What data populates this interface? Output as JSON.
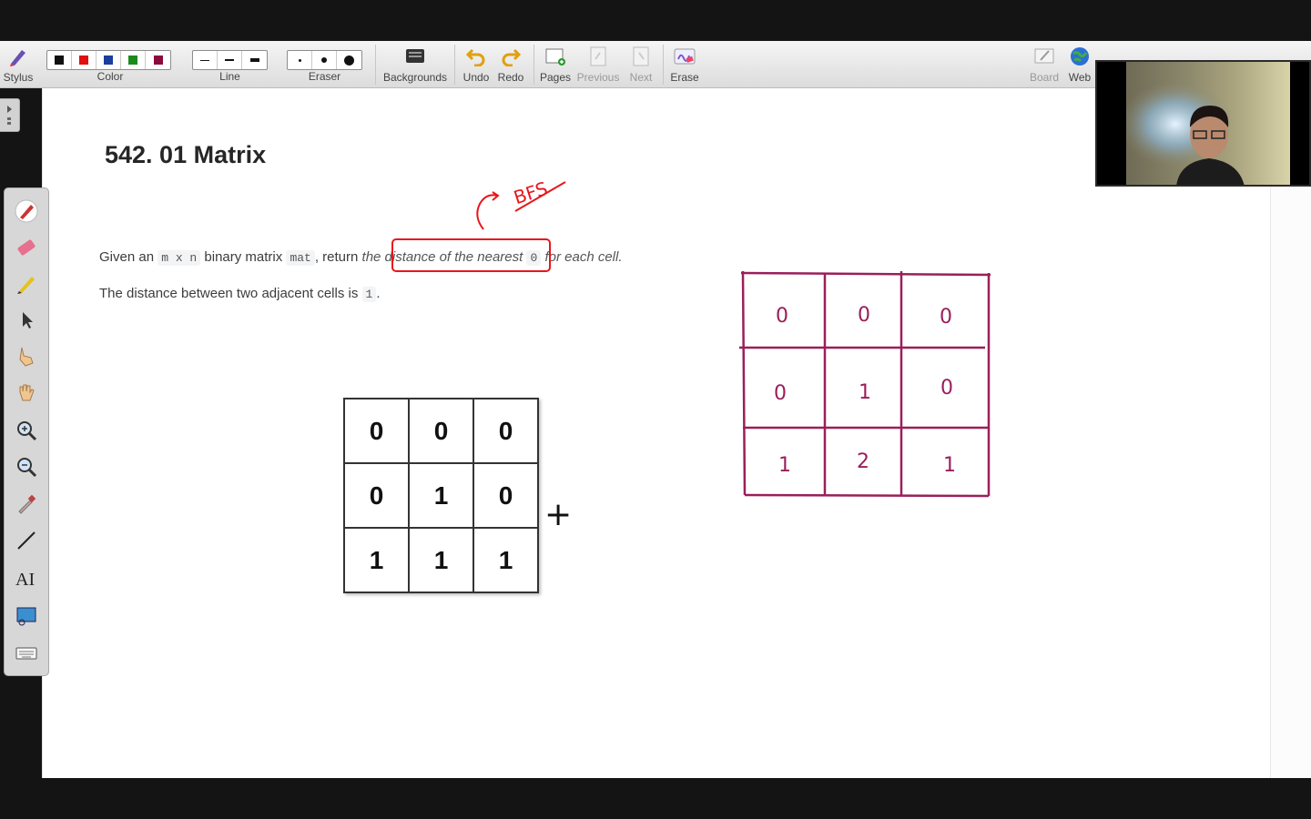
{
  "toolbar": {
    "stylus_label": "Stylus",
    "color_label": "Color",
    "colors": [
      "#111111",
      "#e01010",
      "#1c3f9e",
      "#1a8a1a",
      "#8c0a3c"
    ],
    "line_label": "Line",
    "eraser_label": "Eraser",
    "backgrounds_label": "Backgrounds",
    "undo_label": "Undo",
    "redo_label": "Redo",
    "pages_label": "Pages",
    "previous_label": "Previous",
    "next_label": "Next",
    "erase_label": "Erase",
    "board_label": "Board",
    "web_label": "Web"
  },
  "left_panel": {
    "tools": [
      "pen-icon",
      "eraser-icon",
      "highlighter-icon",
      "select-arrow-icon",
      "pointer-hand-icon",
      "pan-hand-icon",
      "zoom-in-icon",
      "zoom-out-icon",
      "color-picker-icon",
      "line-tool-icon",
      "text-tool-icon",
      "screen-capture-icon",
      "keyboard-icon"
    ]
  },
  "content": {
    "title": "542. 01 Matrix",
    "desc_1": "Given an ",
    "desc_code_1": "m x n",
    "desc_2": " binary matrix ",
    "desc_code_2": "mat",
    "desc_3": ", return ",
    "desc_italic": "the distance of the nearest ",
    "desc_code_3": "0",
    "desc_italic_2": " for each cell.",
    "desc2_text": "The distance between two adjacent cells is ",
    "desc2_code": "1",
    "desc2_end": ".",
    "matrix": [
      [
        "0",
        "0",
        "0"
      ],
      [
        "0",
        "1",
        "0"
      ],
      [
        "1",
        "1",
        "1"
      ]
    ],
    "plus_sign": "+"
  },
  "annotations": {
    "bfs_text": "BFS",
    "bfs_color": "#e8161c",
    "grid_color": "#9a1f5a",
    "handwritten_grid": [
      [
        "0",
        "0",
        "0"
      ],
      [
        "0",
        "1",
        "0"
      ],
      [
        "1",
        "2",
        "1"
      ]
    ]
  }
}
